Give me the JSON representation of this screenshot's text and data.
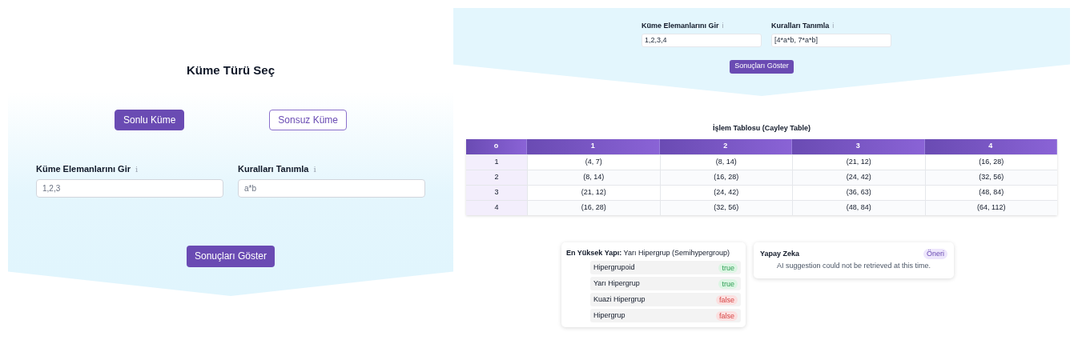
{
  "left": {
    "title": "Küme Türü Seç",
    "set_types": [
      {
        "label": "Sonlu Küme",
        "selected": true
      },
      {
        "label": "Sonsuz Küme",
        "selected": false
      }
    ],
    "fields": [
      {
        "label": "Küme Elemanlarını Gir",
        "info": "i",
        "placeholder": "1,2,3"
      },
      {
        "label": "Kuralları Tanımla",
        "info": "i",
        "placeholder": "a*b"
      }
    ],
    "submit": "Sonuçları Göster"
  },
  "right": {
    "fields": [
      {
        "label": "Küme Elemanlarını Gir",
        "info": "i",
        "value": "1,2,3,4"
      },
      {
        "label": "Kuralları Tanımla",
        "info": "i",
        "value": "[4*a*b, 7*a*b]"
      }
    ],
    "submit": "Sonuçları Göster",
    "table": {
      "title": "İşlem Tablosu (Cayley Table)",
      "columns": [
        "o",
        "1",
        "2",
        "3",
        "4"
      ],
      "rows": [
        [
          "1",
          "(4, 7)",
          "(8, 14)",
          "(21, 12)",
          "(16, 28)"
        ],
        [
          "2",
          "(8, 14)",
          "(16, 28)",
          "(24, 42)",
          "(32, 56)"
        ],
        [
          "3",
          "(21, 12)",
          "(24, 42)",
          "(36, 63)",
          "(48, 84)"
        ],
        [
          "4",
          "(16, 28)",
          "(32, 56)",
          "(48, 84)",
          "(64, 112)"
        ]
      ]
    },
    "structure": {
      "heading": "En Yüksek Yapı:",
      "value": "Yarı Hipergrup (Semihypergroup)",
      "properties": [
        {
          "name": "Hipergrupoid",
          "result": "true",
          "holds": true
        },
        {
          "name": "Yarı Hipergrup",
          "result": "true",
          "holds": true
        },
        {
          "name": "Kuazi Hipergrup",
          "result": "false",
          "holds": false
        },
        {
          "name": "Hipergrup",
          "result": "false",
          "holds": false
        }
      ]
    },
    "ai": {
      "title": "Yapay Zeka",
      "badge": "Öneri",
      "message": "AI suggestion could not be retrieved at this time."
    }
  }
}
